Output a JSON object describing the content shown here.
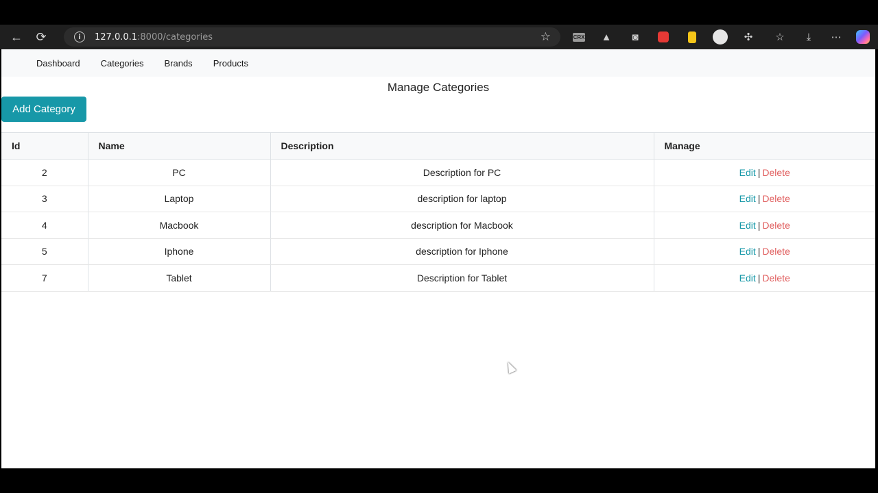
{
  "browser": {
    "url_host": "127.0.0.1",
    "url_rest": ":8000/categories"
  },
  "nav": {
    "items": [
      "Dashboard",
      "Categories",
      "Brands",
      "Products"
    ]
  },
  "page": {
    "title": "Manage Categories",
    "add_button": "Add Category"
  },
  "table": {
    "headers": [
      "Id",
      "Name",
      "Description",
      "Manage"
    ],
    "rows": [
      {
        "id": "2",
        "name": "PC",
        "description": "Description for PC",
        "edit": "Edit",
        "sep": "|",
        "delete": "Delete"
      },
      {
        "id": "3",
        "name": "Laptop",
        "description": "description for laptop",
        "edit": "Edit",
        "sep": "|",
        "delete": "Delete"
      },
      {
        "id": "4",
        "name": "Macbook",
        "description": "description for Macbook",
        "edit": "Edit",
        "sep": "|",
        "delete": "Delete"
      },
      {
        "id": "5",
        "name": "Iphone",
        "description": "description for Iphone",
        "edit": "Edit",
        "sep": "|",
        "delete": "Delete"
      },
      {
        "id": "7",
        "name": "Tablet",
        "description": "Description for Tablet",
        "edit": "Edit",
        "sep": "|",
        "delete": "Delete"
      }
    ]
  },
  "colors": {
    "accent": "#1798a8",
    "delete": "#e05d5d",
    "navbar_bg": "#f8f9fa"
  },
  "icons": {
    "crx_label": "CRX"
  }
}
